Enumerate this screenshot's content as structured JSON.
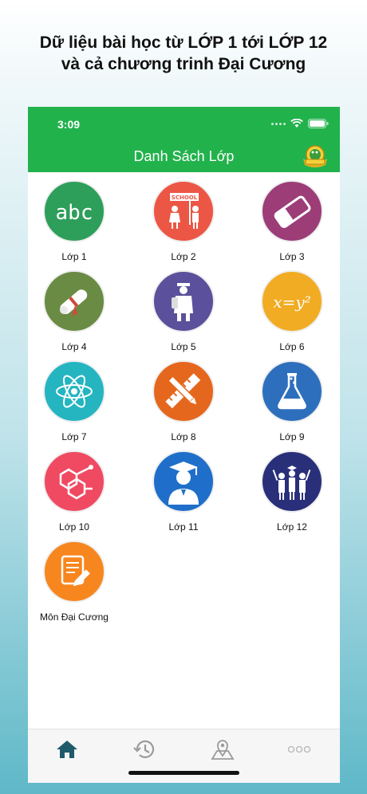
{
  "headline": {
    "line1": "Dữ liệu bài học từ LỚP 1 tới LỚP 12",
    "line2": "và cả chương trinh Đại Cương"
  },
  "status_bar": {
    "time": "3:09"
  },
  "nav": {
    "title": "Danh Sách Lớp"
  },
  "colors": {
    "primary": "#22b24c",
    "tab_active": "#1f5a6a",
    "tab_inactive": "#9a9a9a"
  },
  "classes": [
    {
      "label": "Lớp 1",
      "icon": "abc-icon",
      "color": "#2e9e5b"
    },
    {
      "label": "Lớp 2",
      "icon": "school-kids-icon",
      "color": "#ec5645"
    },
    {
      "label": "Lớp 3",
      "icon": "eraser-icon",
      "color": "#9c3d78"
    },
    {
      "label": "Lớp 4",
      "icon": "diploma-scroll-icon",
      "color": "#6a8b43"
    },
    {
      "label": "Lớp 5",
      "icon": "student-backpack-icon",
      "color": "#5b509b"
    },
    {
      "label": "Lớp 6",
      "icon": "equation-icon",
      "color": "#f1ac24",
      "text": "x=y²"
    },
    {
      "label": "Lớp 7",
      "icon": "atom-icon",
      "color": "#24b5c1"
    },
    {
      "label": "Lớp 8",
      "icon": "ruler-pencil-icon",
      "color": "#e5671e"
    },
    {
      "label": "Lớp 9",
      "icon": "flask-icon",
      "color": "#2d6fbd"
    },
    {
      "label": "Lớp 10",
      "icon": "molecule-icon",
      "color": "#f04a63"
    },
    {
      "label": "Lớp 11",
      "icon": "graduate-icon",
      "color": "#1f6fca"
    },
    {
      "label": "Lớp 12",
      "icon": "graduates-group-icon",
      "color": "#2a2f7a"
    },
    {
      "label": "Môn Đại Cương",
      "icon": "document-edit-icon",
      "color": "#f7861e"
    }
  ],
  "tabs": [
    {
      "name": "home-icon",
      "active": true
    },
    {
      "name": "history-icon",
      "active": false
    },
    {
      "name": "map-icon",
      "active": false
    },
    {
      "name": "more-icon",
      "active": false
    }
  ]
}
